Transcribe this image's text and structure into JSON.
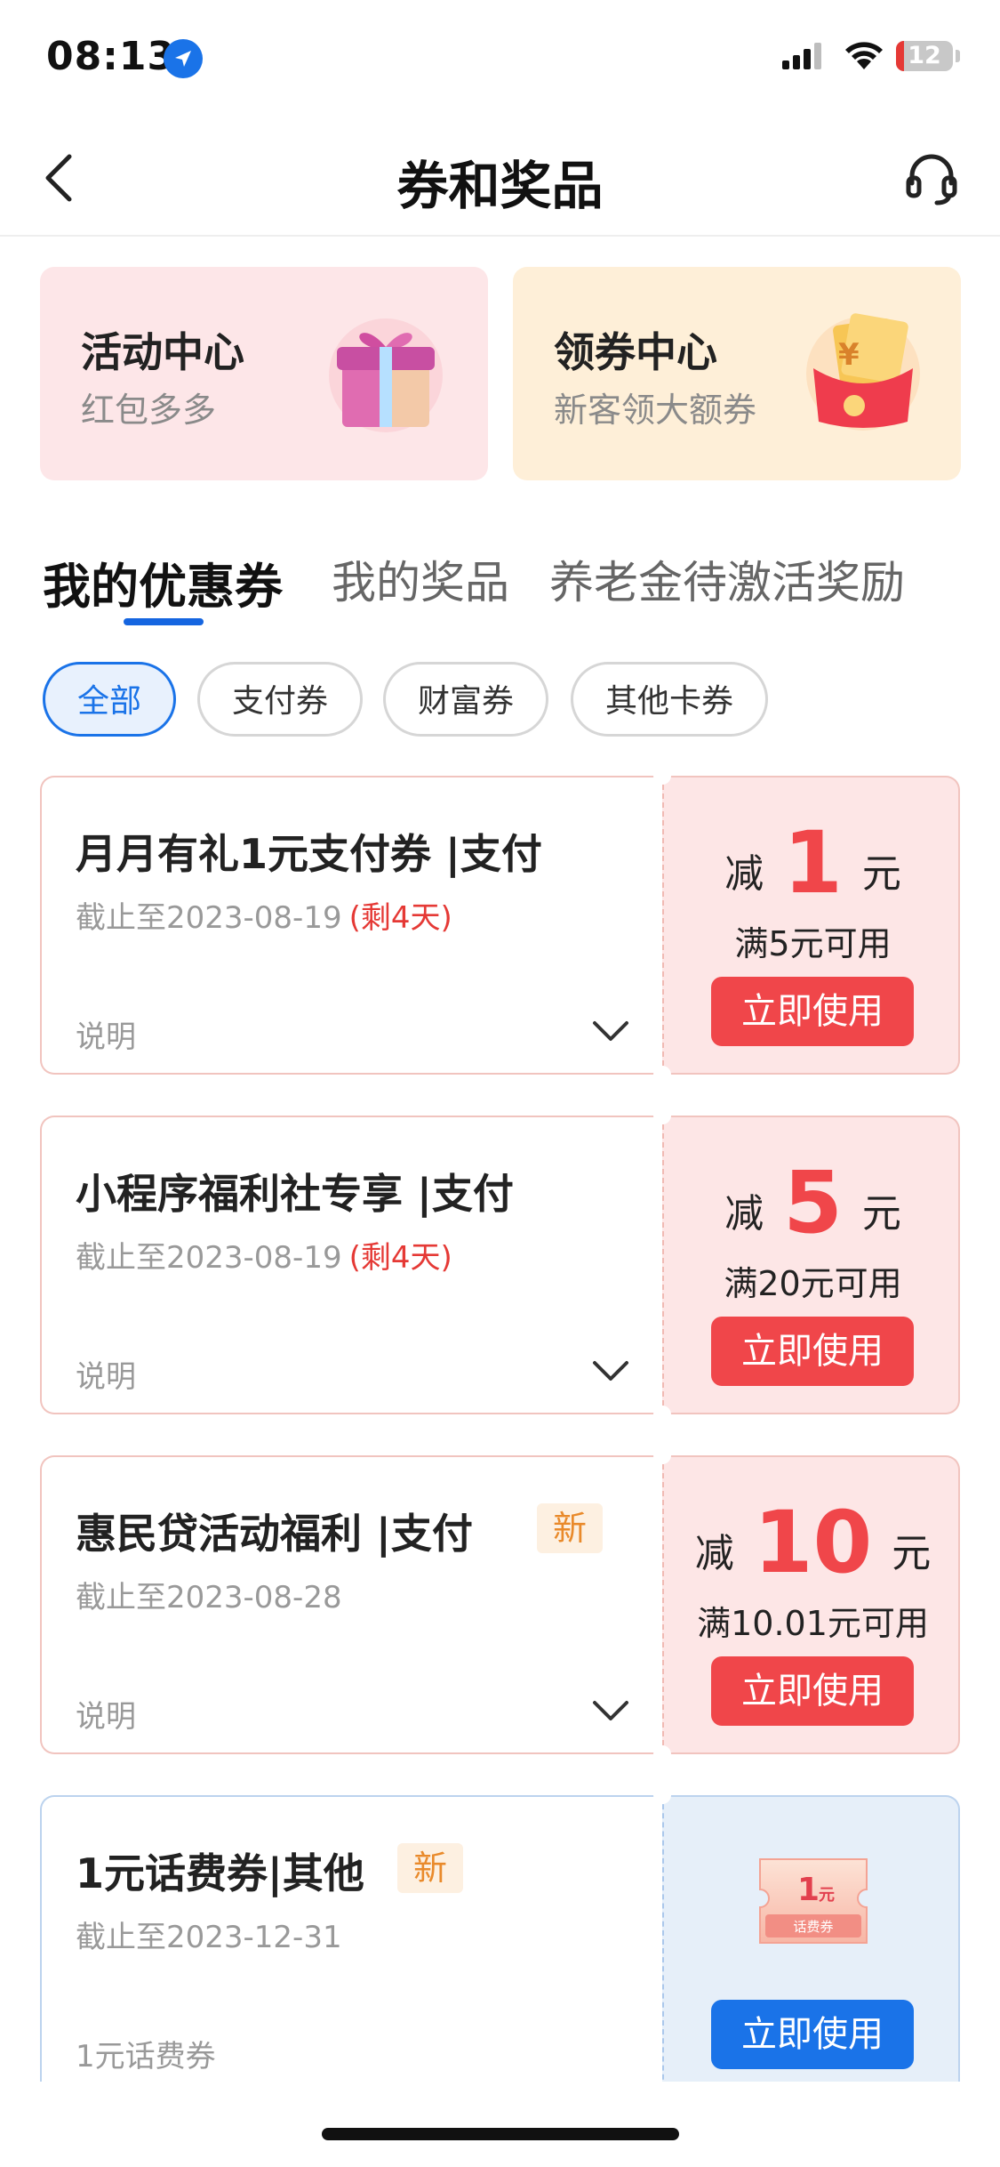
{
  "status_bar": {
    "time": "08:13",
    "battery": "12"
  },
  "nav": {
    "title": "券和奖品"
  },
  "center_cards": [
    {
      "title": "活动中心",
      "subtitle": "红包多多"
    },
    {
      "title": "领券中心",
      "subtitle": "新客领大额券"
    }
  ],
  "tabs": [
    {
      "label": "我的优惠券",
      "active": true
    },
    {
      "label": "我的奖品",
      "active": false
    },
    {
      "label": "养老金待激活奖励",
      "active": false
    }
  ],
  "filters": [
    {
      "label": "全部",
      "active": true
    },
    {
      "label": "支付券",
      "active": false
    },
    {
      "label": "财富券",
      "active": false
    },
    {
      "label": "其他卡券",
      "active": false
    }
  ],
  "coupons": [
    {
      "title": "月月有礼1元支付券",
      "category": "支付",
      "expiry": "截止至2023-08-19",
      "remaining": "(剩4天)",
      "desc": "说明",
      "prefix": "减",
      "amount": "1",
      "unit": "元",
      "condition": "满5元可用",
      "button": "立即使用"
    },
    {
      "title": "小程序福利社专享",
      "category": "支付",
      "expiry": "截止至2023-08-19",
      "remaining": "(剩4天)",
      "desc": "说明",
      "prefix": "减",
      "amount": "5",
      "unit": "元",
      "condition": "满20元可用",
      "button": "立即使用"
    },
    {
      "title": "惠民贷活动福利",
      "category": "支付",
      "badge": "新",
      "expiry": "截止至2023-08-28",
      "desc": "说明",
      "prefix": "减",
      "amount": "10",
      "unit": "元",
      "condition": "满10.01元可用",
      "button": "立即使用"
    },
    {
      "title": "1元话费券",
      "category": "其他",
      "badge": "新",
      "expiry": "截止至2023-12-31",
      "desc": "1元话费券",
      "ticket_amount": "1",
      "ticket_unit": "元",
      "ticket_label": "话费券",
      "button": "立即使用"
    }
  ],
  "colors": {
    "accent_red": "#f0464a",
    "accent_blue": "#1a73e8",
    "badge_orange": "#e98a2b"
  }
}
